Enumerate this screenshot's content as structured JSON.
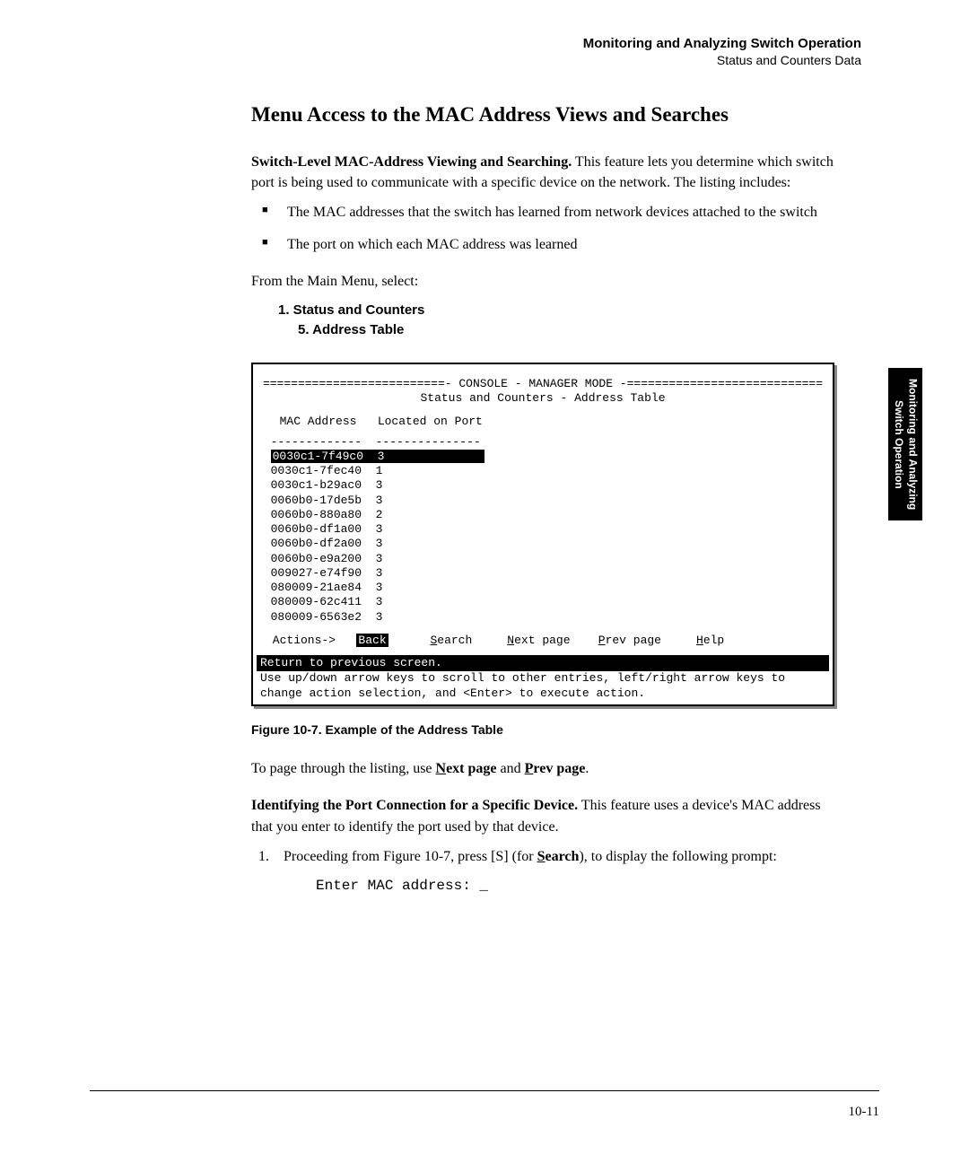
{
  "header": {
    "title": "Monitoring and Analyzing Switch Operation",
    "subtitle": "Status and Counters Data"
  },
  "sectionHeading": "Menu Access to the MAC Address Views and Searches",
  "para1": {
    "boldLead": "Switch-Level MAC-Address Viewing and Searching.",
    "rest": "  This feature lets you determine which switch port is being used to communicate with a specific device on the network. The listing includes:"
  },
  "bullets": [
    "The MAC addresses that the switch has learned from network devices attached to the switch",
    "The port on which each MAC address was learned"
  ],
  "fromMain": "From the Main Menu, select:",
  "menuPath": {
    "line1": "1. Status and Counters",
    "line2": "5. Address Table"
  },
  "console": {
    "headerLine": "==========================- CONSOLE - MANAGER MODE -============================",
    "subtitle": "Status and Counters - Address Table",
    "col1": "  MAC Address",
    "col2": "Located on Port",
    "sep": "  -------------  ---------------",
    "rows": [
      {
        "mac": "0030c1-7f49c0",
        "port": "3",
        "selected": true
      },
      {
        "mac": "0030c1-7fec40",
        "port": "1",
        "selected": false
      },
      {
        "mac": "0030c1-b29ac0",
        "port": "3",
        "selected": false
      },
      {
        "mac": "0060b0-17de5b",
        "port": "3",
        "selected": false
      },
      {
        "mac": "0060b0-880a80",
        "port": "2",
        "selected": false
      },
      {
        "mac": "0060b0-df1a00",
        "port": "3",
        "selected": false
      },
      {
        "mac": "0060b0-df2a00",
        "port": "3",
        "selected": false
      },
      {
        "mac": "0060b0-e9a200",
        "port": "3",
        "selected": false
      },
      {
        "mac": "009027-e74f90",
        "port": "3",
        "selected": false
      },
      {
        "mac": "080009-21ae84",
        "port": "3",
        "selected": false
      },
      {
        "mac": "080009-62c411",
        "port": "3",
        "selected": false
      },
      {
        "mac": "080009-6563e2",
        "port": "3",
        "selected": false
      }
    ],
    "actionsLabel": " Actions->",
    "actions": {
      "back": "Back",
      "search": "Search",
      "nextpage": "Next page",
      "prevpage": "Prev page",
      "help": "Help"
    },
    "footerBar": "Return to previous screen.",
    "footerText1": "Use up/down arrow keys to scroll to other entries, left/right arrow keys to",
    "footerText2": "change action selection, and <Enter> to execute action."
  },
  "figureCaption": "Figure 10-7.  Example of the Address Table",
  "pagePara": {
    "pre": "To page through the listing, use ",
    "b1": "Next page",
    "mid": " and ",
    "b2": "Prev page",
    "post": "."
  },
  "para2": {
    "boldLead": "Identifying the Port Connection for a Specific Device.",
    "rest": "  This feature uses a device's MAC address that you enter to identify the port used by that device."
  },
  "step1": {
    "num": "1.",
    "pre": "Proceeding from Figure 10-7, press [S] (for ",
    "bold": "Search",
    "post": "), to display the following prompt:"
  },
  "codeLine": "Enter MAC address: _",
  "sideTab": {
    "line1": "Monitoring and Analyzing",
    "line2": "Switch Operation"
  },
  "pageNumber": "10-11"
}
